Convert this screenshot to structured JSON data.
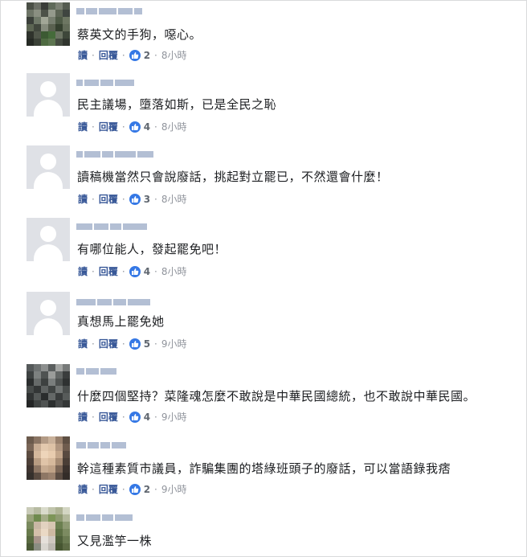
{
  "actions": {
    "read_label": "讀",
    "reply_label": "回覆",
    "separator": "·"
  },
  "comments": [
    {
      "author": "",
      "text": "蔡英文的手狗，噁心。",
      "likes": "2",
      "time": "8小時",
      "avatar": "photo"
    },
    {
      "author": "",
      "text": "民主議場，墮落如斯，已是全民之恥",
      "likes": "4",
      "time": "8小時",
      "avatar": "default"
    },
    {
      "author": "",
      "text": "讀稿機當然只會說廢話，挑起對立罷已，不然還會什麼！",
      "likes": "3",
      "time": "8小時",
      "avatar": "default"
    },
    {
      "author": "",
      "text": "有哪位能人，發起罷免吧！",
      "likes": "4",
      "time": "8小時",
      "avatar": "default"
    },
    {
      "author": "",
      "text": "真想馬上罷免她",
      "likes": "5",
      "time": "9小時",
      "avatar": "default"
    },
    {
      "author": "",
      "text": "什麼四個堅持？菜隆魂怎麼不敢說是中華民國總統，也不敢說中華民國。",
      "likes": "4",
      "time": "9小時",
      "avatar": "photo"
    },
    {
      "author": "",
      "text": "幹這種素質市議員，詐騙集團的塔綠班頭子的廢話，可以當語錄我痞",
      "likes": "2",
      "time": "9小時",
      "avatar": "photo"
    },
    {
      "author": "",
      "text": "又見濫竽一株",
      "likes": "",
      "time": "",
      "avatar": "photo"
    }
  ],
  "colors": {
    "link": "#385898",
    "like_badge": "#3578e5",
    "meta": "#90949c"
  }
}
